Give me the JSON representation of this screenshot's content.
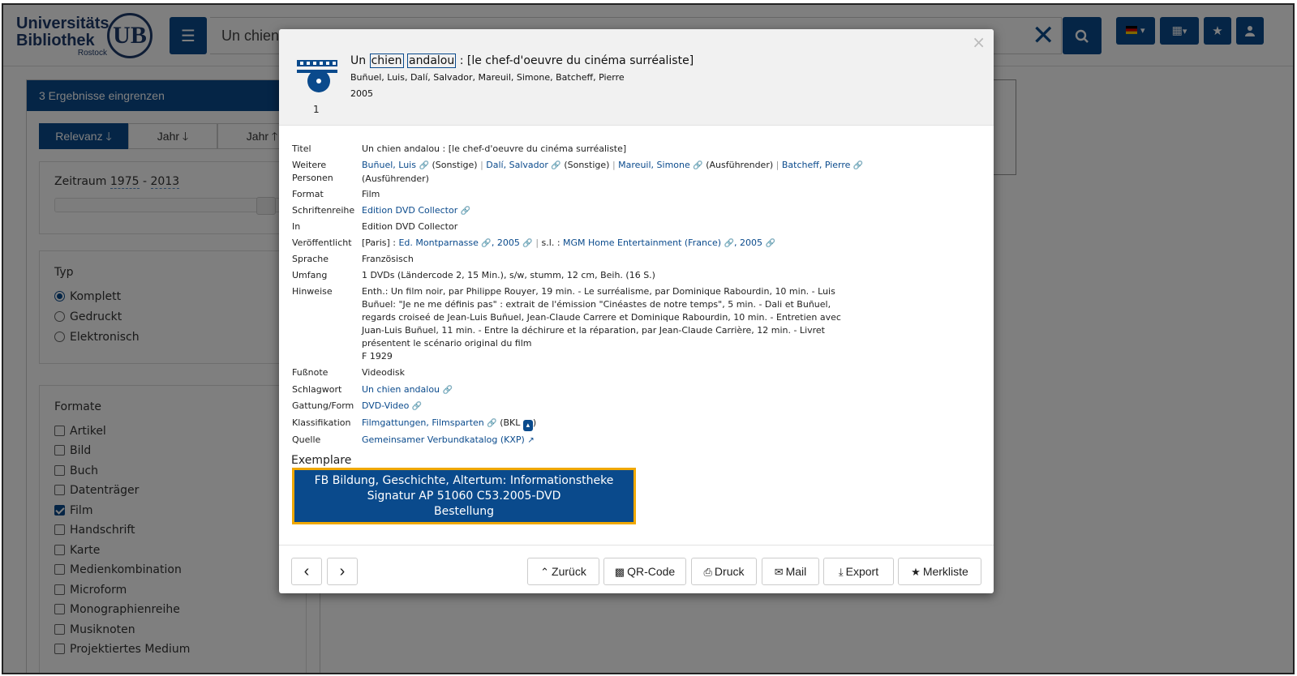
{
  "header": {
    "logo_line1": "Universitäts",
    "logo_line2": "Bibliothek",
    "logo_line3": "Rostock",
    "logo_mark": "UB",
    "search_value": "Un chien",
    "filter_icon": "sliders-icon",
    "clear_icon": "times-icon",
    "search_icon": "search-icon",
    "lang_icon": "flag-de-icon",
    "grid_icon": "grid-icon",
    "star_icon": "star-icon",
    "user_icon": "user-icon"
  },
  "sidebar": {
    "title": "3 Ergebnisse eingrenzen",
    "sort": [
      "Relevanz",
      "Jahr",
      "Jahr"
    ],
    "range_label": "Zeitraum",
    "range_from": "1975",
    "range_dash": "-",
    "range_to": "2013",
    "typ_title": "Typ",
    "typ_options": [
      "Komplett",
      "Gedruckt",
      "Elektronisch"
    ],
    "formate_title": "Formate",
    "formate_options": [
      "Artikel",
      "Bild",
      "Buch",
      "Datenträger",
      "Film",
      "Handschrift",
      "Karte",
      "Medienkombination",
      "Microform",
      "Monographienreihe",
      "Musiknoten",
      "Projektiertes Medium"
    ]
  },
  "modal": {
    "close": "×",
    "record_number": "1",
    "title_prefix": "Un",
    "title_hl1": "chien",
    "title_hl2": "andalou",
    "title_suffix": ": [le chef-d'oeuvre du cinéma surréaliste]",
    "authors": "Buñuel, Luis, Dalí, Salvador, Mareuil, Simone, Batcheff, Pierre",
    "year": "2005",
    "details": {
      "titel_k": "Titel",
      "titel_v": "Un chien andalou : [le chef-d'oeuvre du cinéma surréaliste]",
      "personen_k1": "Weitere",
      "personen_k2": "Personen",
      "p1": "Buñuel, Luis",
      "p1_role": "(Sonstige)",
      "p2": "Dalí, Salvador",
      "p2_role": "(Sonstige)",
      "p3": "Mareuil, Simone",
      "p3_role": "(Ausführender)",
      "p4": "Batcheff, Pierre",
      "p4_role": "(Ausführender)",
      "format_k": "Format",
      "format_v": "Film",
      "reihe_k": "Schriftenreihe",
      "reihe_v": "Edition DVD Collector",
      "in_k": "In",
      "in_v": "Edition DVD Collector",
      "veroeff_k": "Veröffentlicht",
      "veroeff_pre": "[Paris] :",
      "veroeff_l1": "Ed. Montparnasse",
      "veroeff_l2": "2005",
      "veroeff_mid": "s.l. :",
      "veroeff_l3": "MGM Home Entertainment (France)",
      "veroeff_l4": "2005",
      "sprache_k": "Sprache",
      "sprache_v": "Französisch",
      "umfang_k": "Umfang",
      "umfang_v": "1 DVDs (Ländercode 2, 15 Min.), s/w, stumm, 12 cm, Beih. (16 S.)",
      "hinweise_k": "Hinweise",
      "hinweise_lines": [
        "Enth.: Un film noir, par Philippe Rouyer, 19 min. - Le surréalisme, par Dominique Rabourdin, 10 min. - Luis",
        "Buñuel: \"Je ne me définis pas\" : extrait de l'émission \"Cinéastes de notre temps\", 5 min. - Dali et Buñuel,",
        "regards croiseé de Jean-Luis Buñuel, Jean-Claude Carrere et Dominique Rabourdin, 10 min. - Entretien avec",
        "Juan-Luis Buñuel, 11 min. - Entre la déchirure et la réparation, par Jean-Claude Carrière, 12 min. - Livret",
        "présentent le scénario original du film",
        "F 1929"
      ],
      "fussnote_k": "Fußnote",
      "fussnote_v": "Videodisk",
      "schlagwort_k": "Schlagwort",
      "schlagwort_v": "Un chien andalou",
      "gattung_k": "Gattung/Form",
      "gattung_v": "DVD-Video",
      "klass_k": "Klassifikation",
      "klass_v": "Filmgattungen, Filmsparten",
      "klass_open": "(BKL",
      "klass_close": ")",
      "quelle_k": "Quelle",
      "quelle_v": "Gemeinsamer Verbundkatalog (KXP)"
    },
    "exemplare_title": "Exemplare",
    "exemplar_line1": "FB Bildung, Geschichte, Altertum: Informationstheke",
    "exemplar_line2": "Signatur AP 51060 C53.2005-DVD",
    "exemplar_line3": "Bestellung",
    "footer": {
      "prev": "‹",
      "next": "›",
      "back": "Zurück",
      "qr": "QR-Code",
      "print": "Druck",
      "mail": "Mail",
      "export": "Export",
      "merkliste": "Merkliste"
    }
  },
  "colors": {
    "primary": "#0a4a8c",
    "highlight_border": "#f0a800"
  }
}
